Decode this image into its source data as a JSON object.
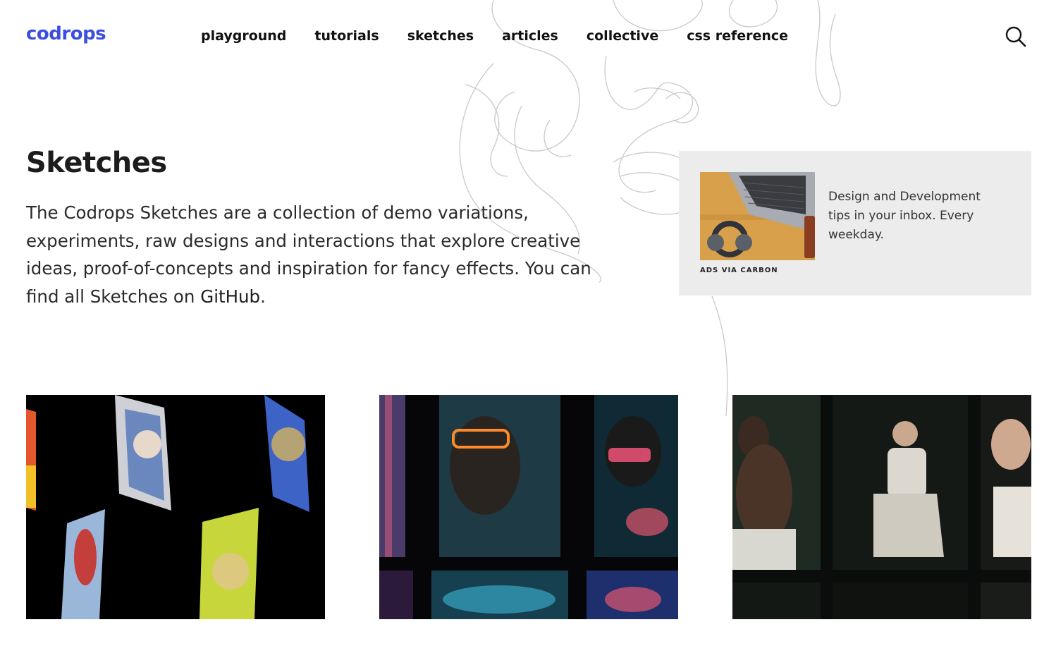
{
  "site": {
    "logo": "codrops",
    "accent_color": "#3b4ee0"
  },
  "nav": {
    "items": [
      {
        "label": "playground"
      },
      {
        "label": "tutorials"
      },
      {
        "label": "sketches"
      },
      {
        "label": "articles"
      },
      {
        "label": "collective"
      },
      {
        "label": "css reference"
      }
    ],
    "search_icon": "search-icon"
  },
  "page": {
    "title": "Sketches",
    "intro_text": "The Codrops Sketches are a collection of demo variations, experiments, raw designs and interactions that explore creative ideas, proof-of-concepts and inspiration for fancy effects. You can find all Sketches on ",
    "intro_link": "GitHub",
    "intro_end": "."
  },
  "ad": {
    "text": "Design and Development tips in your inbox. Every weekday.",
    "via_label": "ADS VIA CARBON",
    "background": "#ececec"
  },
  "sketches": [
    {
      "thumbnail": "sketch-thumbnail-1"
    },
    {
      "thumbnail": "sketch-thumbnail-2"
    },
    {
      "thumbnail": "sketch-thumbnail-3"
    }
  ]
}
